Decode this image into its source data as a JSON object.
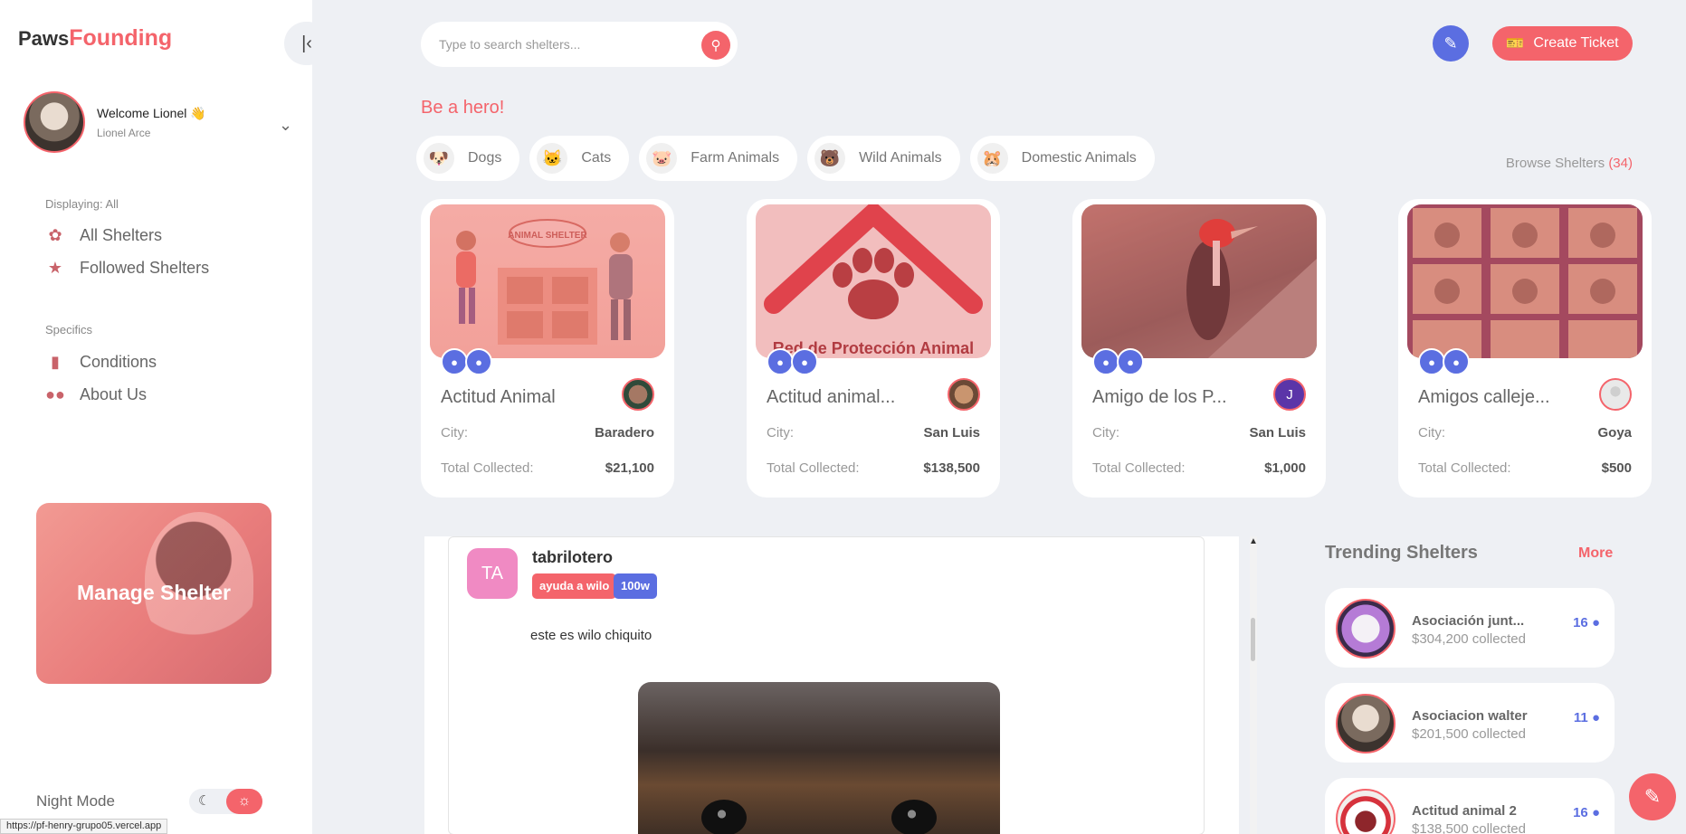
{
  "brand": {
    "part1": "Paws",
    "part2": "Founding"
  },
  "user": {
    "welcome": "Welcome Lionel 👋",
    "name": "Lionel Arce"
  },
  "nav": {
    "displaying_label": "Displaying: All",
    "all_shelters": "All Shelters",
    "followed_shelters": "Followed Shelters",
    "specifics_label": "Specifics",
    "conditions": "Conditions",
    "about_us": "About Us"
  },
  "manage_shelter": "Manage Shelter",
  "night_mode": "Night Mode",
  "status_url": "https://pf-henry-grupo05.vercel.app",
  "search": {
    "placeholder": "Type to search shelters..."
  },
  "create_ticket": "Create Ticket",
  "hero_title": "Be a hero!",
  "categories": [
    {
      "emoji": "🐶",
      "label": "Dogs"
    },
    {
      "emoji": "🐱",
      "label": "Cats"
    },
    {
      "emoji": "🐷",
      "label": "Farm Animals"
    },
    {
      "emoji": "🐻",
      "label": "Wild Animals"
    },
    {
      "emoji": "🐹",
      "label": "Domestic Animals"
    }
  ],
  "browse": {
    "label": "Browse Shelters",
    "count": "(34)"
  },
  "shelter_labels": {
    "city": "City:",
    "total": "Total Collected:"
  },
  "shelters": [
    {
      "name": "Actitud Animal",
      "city": "Baradero",
      "total": "$21,100",
      "owner": ""
    },
    {
      "name": "Actitud animal...",
      "city": "San Luis",
      "total": "$138,500",
      "owner": ""
    },
    {
      "name": "Amigo de los P...",
      "city": "San Luis",
      "total": "$1,000",
      "owner": "J"
    },
    {
      "name": "Amigos calleje...",
      "city": "Goya",
      "total": "$500",
      "owner": ""
    }
  ],
  "card_image_texts": {
    "shelter_sign": "ANIMAL SHELTER",
    "red_title": "Red de Protección Animal"
  },
  "post": {
    "initials": "TA",
    "user": "tabrilotero",
    "badge1": "ayuda a wilo",
    "badge2": "100w",
    "text": "este es wilo chiquito"
  },
  "trending": {
    "title": "Trending Shelters",
    "more": "More",
    "items": [
      {
        "name": "Asociación junt...",
        "amount": "$304,200 collected",
        "count": "16"
      },
      {
        "name": "Asociacion walter",
        "amount": "$201,500 collected",
        "count": "11"
      },
      {
        "name": "Actitud animal 2",
        "amount": "$138,500 collected",
        "count": "16"
      }
    ]
  },
  "colors": {
    "accent": "#f4646b",
    "secondary": "#5b6ee1",
    "background": "#eef0f4"
  }
}
